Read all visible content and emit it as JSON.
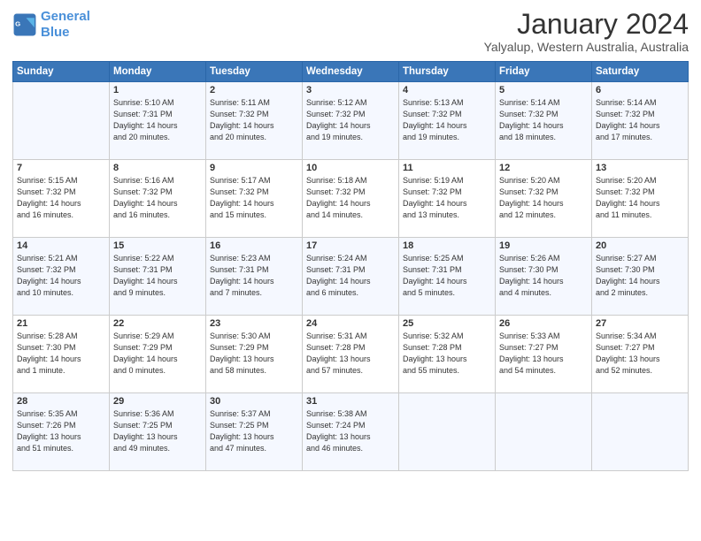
{
  "header": {
    "logo_line1": "General",
    "logo_line2": "Blue",
    "month": "January 2024",
    "location": "Yalyalup, Western Australia, Australia"
  },
  "weekdays": [
    "Sunday",
    "Monday",
    "Tuesday",
    "Wednesday",
    "Thursday",
    "Friday",
    "Saturday"
  ],
  "weeks": [
    [
      {
        "day": "",
        "info": ""
      },
      {
        "day": "1",
        "info": "Sunrise: 5:10 AM\nSunset: 7:31 PM\nDaylight: 14 hours\nand 20 minutes."
      },
      {
        "day": "2",
        "info": "Sunrise: 5:11 AM\nSunset: 7:32 PM\nDaylight: 14 hours\nand 20 minutes."
      },
      {
        "day": "3",
        "info": "Sunrise: 5:12 AM\nSunset: 7:32 PM\nDaylight: 14 hours\nand 19 minutes."
      },
      {
        "day": "4",
        "info": "Sunrise: 5:13 AM\nSunset: 7:32 PM\nDaylight: 14 hours\nand 19 minutes."
      },
      {
        "day": "5",
        "info": "Sunrise: 5:14 AM\nSunset: 7:32 PM\nDaylight: 14 hours\nand 18 minutes."
      },
      {
        "day": "6",
        "info": "Sunrise: 5:14 AM\nSunset: 7:32 PM\nDaylight: 14 hours\nand 17 minutes."
      }
    ],
    [
      {
        "day": "7",
        "info": "Sunrise: 5:15 AM\nSunset: 7:32 PM\nDaylight: 14 hours\nand 16 minutes."
      },
      {
        "day": "8",
        "info": "Sunrise: 5:16 AM\nSunset: 7:32 PM\nDaylight: 14 hours\nand 16 minutes."
      },
      {
        "day": "9",
        "info": "Sunrise: 5:17 AM\nSunset: 7:32 PM\nDaylight: 14 hours\nand 15 minutes."
      },
      {
        "day": "10",
        "info": "Sunrise: 5:18 AM\nSunset: 7:32 PM\nDaylight: 14 hours\nand 14 minutes."
      },
      {
        "day": "11",
        "info": "Sunrise: 5:19 AM\nSunset: 7:32 PM\nDaylight: 14 hours\nand 13 minutes."
      },
      {
        "day": "12",
        "info": "Sunrise: 5:20 AM\nSunset: 7:32 PM\nDaylight: 14 hours\nand 12 minutes."
      },
      {
        "day": "13",
        "info": "Sunrise: 5:20 AM\nSunset: 7:32 PM\nDaylight: 14 hours\nand 11 minutes."
      }
    ],
    [
      {
        "day": "14",
        "info": "Sunrise: 5:21 AM\nSunset: 7:32 PM\nDaylight: 14 hours\nand 10 minutes."
      },
      {
        "day": "15",
        "info": "Sunrise: 5:22 AM\nSunset: 7:31 PM\nDaylight: 14 hours\nand 9 minutes."
      },
      {
        "day": "16",
        "info": "Sunrise: 5:23 AM\nSunset: 7:31 PM\nDaylight: 14 hours\nand 7 minutes."
      },
      {
        "day": "17",
        "info": "Sunrise: 5:24 AM\nSunset: 7:31 PM\nDaylight: 14 hours\nand 6 minutes."
      },
      {
        "day": "18",
        "info": "Sunrise: 5:25 AM\nSunset: 7:31 PM\nDaylight: 14 hours\nand 5 minutes."
      },
      {
        "day": "19",
        "info": "Sunrise: 5:26 AM\nSunset: 7:30 PM\nDaylight: 14 hours\nand 4 minutes."
      },
      {
        "day": "20",
        "info": "Sunrise: 5:27 AM\nSunset: 7:30 PM\nDaylight: 14 hours\nand 2 minutes."
      }
    ],
    [
      {
        "day": "21",
        "info": "Sunrise: 5:28 AM\nSunset: 7:30 PM\nDaylight: 14 hours\nand 1 minute."
      },
      {
        "day": "22",
        "info": "Sunrise: 5:29 AM\nSunset: 7:29 PM\nDaylight: 14 hours\nand 0 minutes."
      },
      {
        "day": "23",
        "info": "Sunrise: 5:30 AM\nSunset: 7:29 PM\nDaylight: 13 hours\nand 58 minutes."
      },
      {
        "day": "24",
        "info": "Sunrise: 5:31 AM\nSunset: 7:28 PM\nDaylight: 13 hours\nand 57 minutes."
      },
      {
        "day": "25",
        "info": "Sunrise: 5:32 AM\nSunset: 7:28 PM\nDaylight: 13 hours\nand 55 minutes."
      },
      {
        "day": "26",
        "info": "Sunrise: 5:33 AM\nSunset: 7:27 PM\nDaylight: 13 hours\nand 54 minutes."
      },
      {
        "day": "27",
        "info": "Sunrise: 5:34 AM\nSunset: 7:27 PM\nDaylight: 13 hours\nand 52 minutes."
      }
    ],
    [
      {
        "day": "28",
        "info": "Sunrise: 5:35 AM\nSunset: 7:26 PM\nDaylight: 13 hours\nand 51 minutes."
      },
      {
        "day": "29",
        "info": "Sunrise: 5:36 AM\nSunset: 7:25 PM\nDaylight: 13 hours\nand 49 minutes."
      },
      {
        "day": "30",
        "info": "Sunrise: 5:37 AM\nSunset: 7:25 PM\nDaylight: 13 hours\nand 47 minutes."
      },
      {
        "day": "31",
        "info": "Sunrise: 5:38 AM\nSunset: 7:24 PM\nDaylight: 13 hours\nand 46 minutes."
      },
      {
        "day": "",
        "info": ""
      },
      {
        "day": "",
        "info": ""
      },
      {
        "day": "",
        "info": ""
      }
    ]
  ]
}
